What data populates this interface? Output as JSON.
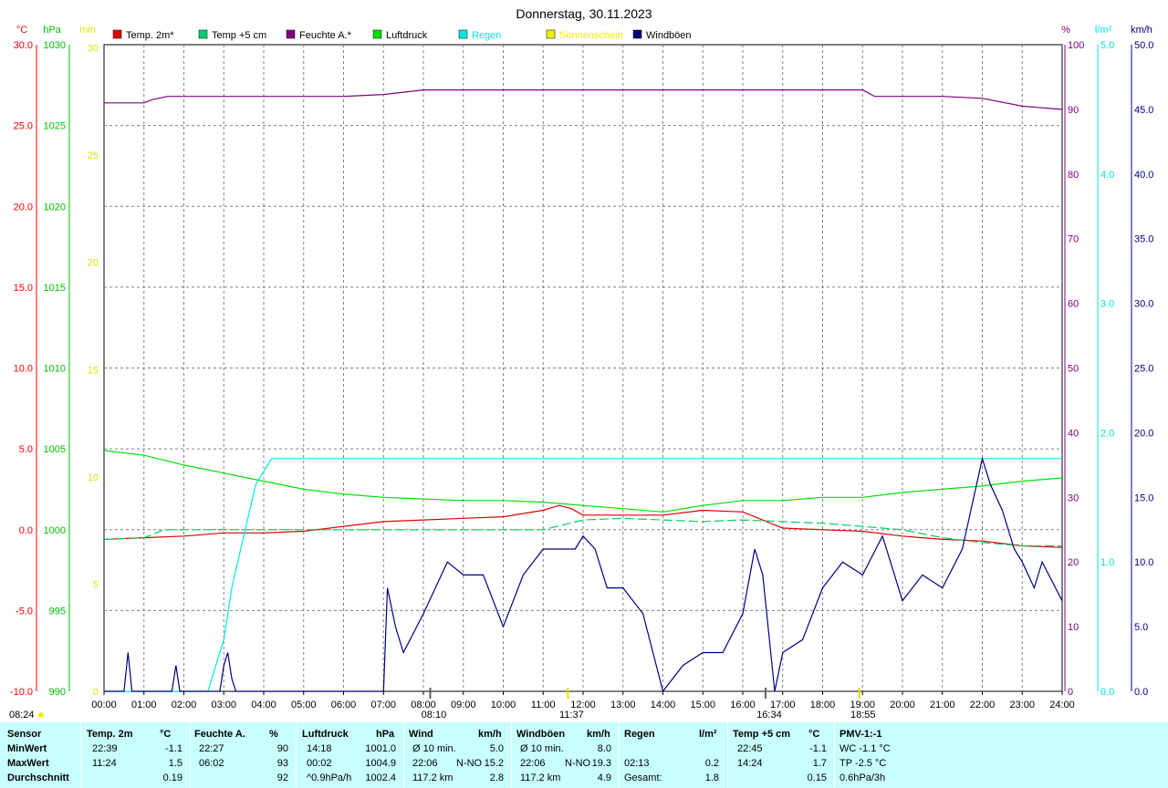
{
  "title": "Donnerstag, 30.11.2023",
  "colors": {
    "temp2m": "#e00000",
    "temp5cm": "#00d060",
    "humidity": "#800080",
    "pressure": "#00e000",
    "rain": "#00e8e8",
    "sun": "#f0f000",
    "gusts": "#000080",
    "wind": "#000080",
    "axis_left_temp": "#ff0000",
    "axis_left_hpa": "#00c000",
    "axis_left_min": "#e0e000",
    "axis_right_pct": "#800080",
    "axis_right_rain": "#00e0e0",
    "axis_right_kmh": "#000080",
    "panel_bg": "#c8ffff",
    "grid": "#808080"
  },
  "legend": [
    {
      "label": "Temp. 2m*",
      "color": "#e00000"
    },
    {
      "label": "Temp +5 cm",
      "color": "#00d070"
    },
    {
      "label": "Feuchte A.*",
      "color": "#800080"
    },
    {
      "label": "Luftdruck",
      "color": "#00e000"
    },
    {
      "label": "Regen",
      "color": "#00e8e8"
    },
    {
      "label": "Sonnenschein",
      "color": "#f0f000"
    },
    {
      "label": "Windböen",
      "color": "#000080"
    }
  ],
  "axes": {
    "temp": {
      "unit": "°C",
      "ticks": [
        "30.0",
        "25.0",
        "20.0",
        "15.0",
        "10.0",
        "5.0",
        "0.0",
        "-5.0",
        "-10.0"
      ]
    },
    "pressure": {
      "unit": "hPa",
      "ticks": [
        "1030",
        "1025",
        "1020",
        "1015",
        "1010",
        "1005",
        "1000",
        "995",
        "990"
      ]
    },
    "sun": {
      "unit": "min",
      "ticks": [
        "30",
        "25",
        "20",
        "15",
        "10",
        "5",
        "0"
      ]
    },
    "humidity": {
      "unit": "%",
      "ticks": [
        "100",
        "90",
        "80",
        "70",
        "60",
        "50",
        "40",
        "30",
        "20",
        "10",
        "0"
      ]
    },
    "rain": {
      "unit": "l/m²",
      "ticks": [
        "5.0",
        "4.0",
        "3.0",
        "2.0",
        "1.0",
        "0.0"
      ]
    },
    "wind": {
      "unit": "km/h",
      "ticks": [
        "50.0",
        "45.0",
        "40.0",
        "35.0",
        "30.0",
        "25.0",
        "20.0",
        "15.0",
        "10.0",
        "5.0",
        "0.0"
      ]
    },
    "x_ticks": [
      "00:00",
      "01:00",
      "02:00",
      "03:00",
      "04:00",
      "05:00",
      "06:00",
      "07:00",
      "08:00",
      "09:00",
      "10:00",
      "11:00",
      "12:00",
      "13:00",
      "14:00",
      "15:00",
      "16:00",
      "17:00",
      "18:00",
      "19:00",
      "20:00",
      "21:00",
      "22:00",
      "23:00",
      "24:00"
    ]
  },
  "markers": [
    {
      "label": "08:24",
      "x_hours": null,
      "row": "bottom-left"
    },
    {
      "label": "08:10",
      "x_hours": 8.17
    },
    {
      "label": "11:37",
      "x_hours": 11.62
    },
    {
      "label": "16:34",
      "x_hours": 16.57
    },
    {
      "label": "18:55",
      "x_hours": 18.92
    }
  ],
  "chart_data": {
    "type": "line",
    "title": "Donnerstag, 30.11.2023",
    "x_unit": "hour",
    "xlim": [
      0,
      24
    ],
    "series": [
      {
        "name": "Temp. 2m*",
        "axis": "temp",
        "ylim": [
          -10,
          30
        ],
        "points": [
          [
            0,
            -0.6
          ],
          [
            1,
            -0.5
          ],
          [
            2,
            -0.4
          ],
          [
            3,
            -0.2
          ],
          [
            4,
            -0.2
          ],
          [
            5,
            -0.1
          ],
          [
            6,
            0.2
          ],
          [
            7,
            0.5
          ],
          [
            8,
            0.6
          ],
          [
            9,
            0.7
          ],
          [
            10,
            0.8
          ],
          [
            11,
            1.2
          ],
          [
            11.4,
            1.5
          ],
          [
            11.7,
            1.3
          ],
          [
            12,
            0.9
          ],
          [
            13,
            0.9
          ],
          [
            14,
            0.9
          ],
          [
            15,
            1.2
          ],
          [
            16,
            1.1
          ],
          [
            17,
            0.1
          ],
          [
            18,
            0.0
          ],
          [
            19,
            -0.1
          ],
          [
            20,
            -0.4
          ],
          [
            21,
            -0.6
          ],
          [
            22,
            -0.7
          ],
          [
            23,
            -1.0
          ],
          [
            24,
            -1.1
          ]
        ]
      },
      {
        "name": "Temp +5 cm",
        "axis": "temp",
        "ylim": [
          -10,
          30
        ],
        "points": [
          [
            0,
            -0.6
          ],
          [
            1,
            -0.5
          ],
          [
            1.5,
            0.0
          ],
          [
            2,
            0.0
          ],
          [
            6,
            0.0
          ],
          [
            7,
            0.0
          ],
          [
            10,
            0.0
          ],
          [
            11,
            0.0
          ],
          [
            12,
            0.6
          ],
          [
            13,
            0.7
          ],
          [
            14,
            0.6
          ],
          [
            15,
            0.5
          ],
          [
            16,
            0.6
          ],
          [
            17,
            0.5
          ],
          [
            18,
            0.4
          ],
          [
            19,
            0.2
          ],
          [
            20,
            0.0
          ],
          [
            21,
            -0.5
          ],
          [
            22,
            -0.8
          ],
          [
            23,
            -1.0
          ],
          [
            24,
            -1.0
          ]
        ]
      },
      {
        "name": "Luftdruck",
        "axis": "pressure",
        "ylim": [
          990,
          1030
        ],
        "points": [
          [
            0,
            1004.9
          ],
          [
            1,
            1004.6
          ],
          [
            2,
            1004.0
          ],
          [
            3,
            1003.5
          ],
          [
            4,
            1003.0
          ],
          [
            5,
            1002.5
          ],
          [
            6,
            1002.2
          ],
          [
            7,
            1002.0
          ],
          [
            8,
            1001.9
          ],
          [
            9,
            1001.8
          ],
          [
            10,
            1001.8
          ],
          [
            11,
            1001.7
          ],
          [
            12,
            1001.5
          ],
          [
            13,
            1001.3
          ],
          [
            14,
            1001.1
          ],
          [
            15,
            1001.5
          ],
          [
            16,
            1001.8
          ],
          [
            17,
            1001.8
          ],
          [
            18,
            1002.0
          ],
          [
            19,
            1002.0
          ],
          [
            20,
            1002.3
          ],
          [
            21,
            1002.5
          ],
          [
            22,
            1002.7
          ],
          [
            23,
            1003.0
          ],
          [
            24,
            1003.2
          ]
        ]
      },
      {
        "name": "Feuchte A.*",
        "axis": "humidity",
        "ylim": [
          0,
          100
        ],
        "points": [
          [
            0,
            91
          ],
          [
            1,
            91
          ],
          [
            1.2,
            91.5
          ],
          [
            1.6,
            92
          ],
          [
            2,
            92
          ],
          [
            6,
            92
          ],
          [
            7,
            92.3
          ],
          [
            8,
            93
          ],
          [
            9,
            93
          ],
          [
            11,
            93
          ],
          [
            13,
            93
          ],
          [
            16,
            93
          ],
          [
            19,
            93
          ],
          [
            19.3,
            92
          ],
          [
            20,
            92
          ],
          [
            21,
            92
          ],
          [
            22,
            91.7
          ],
          [
            23,
            90.5
          ],
          [
            24,
            90
          ]
        ]
      },
      {
        "name": "Regen",
        "axis": "rain",
        "ylim": [
          0,
          5
        ],
        "points": [
          [
            0,
            0
          ],
          [
            2.6,
            0
          ],
          [
            2.7,
            0.1
          ],
          [
            3,
            0.4
          ],
          [
            3.2,
            0.8
          ],
          [
            3.5,
            1.2
          ],
          [
            3.8,
            1.6
          ],
          [
            4.2,
            1.8
          ],
          [
            4.5,
            1.8
          ],
          [
            24,
            1.8
          ]
        ]
      },
      {
        "name": "Windböen",
        "axis": "wind",
        "ylim": [
          0,
          50
        ],
        "points": [
          [
            0,
            0
          ],
          [
            0.5,
            0
          ],
          [
            0.6,
            3
          ],
          [
            0.7,
            0
          ],
          [
            1.7,
            0
          ],
          [
            1.8,
            2
          ],
          [
            1.9,
            0
          ],
          [
            2.9,
            0
          ],
          [
            3.0,
            2
          ],
          [
            3.1,
            3
          ],
          [
            3.2,
            1
          ],
          [
            3.3,
            0
          ],
          [
            7,
            0
          ],
          [
            7.1,
            8
          ],
          [
            7.3,
            5
          ],
          [
            7.5,
            3
          ],
          [
            8,
            6
          ],
          [
            8.3,
            8
          ],
          [
            8.6,
            10
          ],
          [
            9,
            9
          ],
          [
            9.5,
            9
          ],
          [
            10,
            5
          ],
          [
            10.5,
            9
          ],
          [
            11,
            11
          ],
          [
            11.5,
            11
          ],
          [
            11.8,
            11
          ],
          [
            12,
            12
          ],
          [
            12.3,
            11
          ],
          [
            12.6,
            8
          ],
          [
            13,
            8
          ],
          [
            13.5,
            6
          ],
          [
            14,
            0
          ],
          [
            14.5,
            2
          ],
          [
            15,
            3
          ],
          [
            15.5,
            3
          ],
          [
            16,
            6
          ],
          [
            16.3,
            11
          ],
          [
            16.5,
            9
          ],
          [
            16.8,
            0
          ],
          [
            17,
            3
          ],
          [
            17.5,
            4
          ],
          [
            18,
            8
          ],
          [
            18.5,
            10
          ],
          [
            19,
            9
          ],
          [
            19.5,
            12
          ],
          [
            20,
            7
          ],
          [
            20.5,
            9
          ],
          [
            21,
            8
          ],
          [
            21.5,
            11
          ],
          [
            22,
            18
          ],
          [
            22.2,
            16
          ],
          [
            22.5,
            14
          ],
          [
            22.8,
            11
          ],
          [
            23,
            10
          ],
          [
            23.3,
            8
          ],
          [
            23.5,
            10
          ],
          [
            24,
            7
          ]
        ]
      }
    ]
  },
  "stats": {
    "headers": [
      {
        "sensor": "Sensor"
      },
      {
        "name": "Temp. 2m",
        "unit": "°C"
      },
      {
        "name": "Feuchte A.",
        "unit": "%"
      },
      {
        "name": "Luftdruck",
        "unit": "hPa"
      },
      {
        "name": "Wind",
        "unit": "km/h"
      },
      {
        "name": "Windböen",
        "unit": "km/h"
      },
      {
        "name": "Regen",
        "unit": "l/m²"
      },
      {
        "name": "Temp +5 cm",
        "unit": "°C"
      },
      {
        "name": "PMV-1:-1"
      }
    ],
    "rows": [
      {
        "label": "MinWert",
        "temp_time": "22:39",
        "temp_val": "-1.1",
        "hum_time": "22:27",
        "hum_val": "90",
        "press_time": "14:18",
        "press_val": "1001.0",
        "wind_a": "Ø 10 min.",
        "wind_val": "5.0",
        "gust_a": "Ø 10 min.",
        "gust_val": "8.0",
        "rain_a": "",
        "rain_val": "",
        "t5_time": "22:45",
        "t5_val": "-1.1",
        "pmv": "WC -1.1 °C"
      },
      {
        "label": "MaxWert",
        "temp_time": "11:24",
        "temp_val": "1.5",
        "hum_time": "06:02",
        "hum_val": "93",
        "press_time": "00:02",
        "press_val": "1004.9",
        "wind_a": "22:06",
        "wind_dir": "N-NO",
        "wind_val": "15.2",
        "gust_a": "22:06",
        "gust_dir": "N-NO",
        "gust_val": "19.3",
        "rain_a": "02:13",
        "rain_val": "0.2",
        "t5_time": "14:24",
        "t5_val": "1.7",
        "pmv": "TP -2.5 °C"
      },
      {
        "label": "Durchschnitt",
        "temp_time": "",
        "temp_val": "0.19",
        "hum_time": "",
        "hum_val": "92",
        "press_time": "^0.9hPa/h",
        "press_val": "1002.4",
        "wind_a": "117.2 km",
        "wind_val": "2.8",
        "gust_a": "117.2 km",
        "gust_val": "4.9",
        "rain_a": "Gesamt:",
        "rain_val": "1.8",
        "t5_time": "",
        "t5_val": "0.15",
        "pmv": "0.6hPa/3h"
      }
    ]
  }
}
